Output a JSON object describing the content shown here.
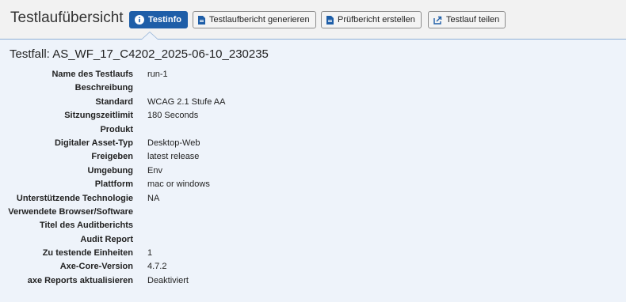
{
  "header": {
    "title": "Testlaufübersicht",
    "buttons": [
      {
        "label": "Testinfo",
        "icon": "info-icon",
        "active": true
      },
      {
        "label": "Testlaufbericht generieren",
        "icon": "document-icon"
      },
      {
        "label": "Prüfbericht erstellen",
        "icon": "document-icon"
      },
      {
        "label": "Testlauf teilen",
        "icon": "share-icon"
      }
    ]
  },
  "testfall": "Testfall: AS_WF_17_C4202_2025-06-10_230235",
  "details": [
    {
      "label": "Name des Testlaufs",
      "value": "run-1"
    },
    {
      "label": "Beschreibung",
      "value": ""
    },
    {
      "label": "Standard",
      "value": "WCAG 2.1 Stufe AA"
    },
    {
      "label": "Sitzungszeitlimit",
      "value": "180 Seconds"
    },
    {
      "label": "Produkt",
      "value": ""
    },
    {
      "label": "Digitaler Asset-Typ",
      "value": "Desktop-Web"
    },
    {
      "label": "Freigeben",
      "value": "latest release"
    },
    {
      "label": "Umgebung",
      "value": "Env"
    },
    {
      "label": "Plattform",
      "value": "mac or windows"
    },
    {
      "label": "Unterstützende Technologie",
      "value": "NA"
    },
    {
      "label": "Verwendete Browser/Software",
      "value": ""
    },
    {
      "label": "Titel des Auditberichts",
      "value": ""
    },
    {
      "label": "Audit Report",
      "value": ""
    },
    {
      "label": "Zu testende Einheiten",
      "value": "1"
    },
    {
      "label": "Axe-Core-Version",
      "value": "4.7.2"
    },
    {
      "label": "axe Reports aktualisieren",
      "value": "Deaktiviert"
    }
  ],
  "colors": {
    "accent": "#1e5ea8",
    "background": "#eef3fa",
    "header": "#f2f2f2"
  }
}
